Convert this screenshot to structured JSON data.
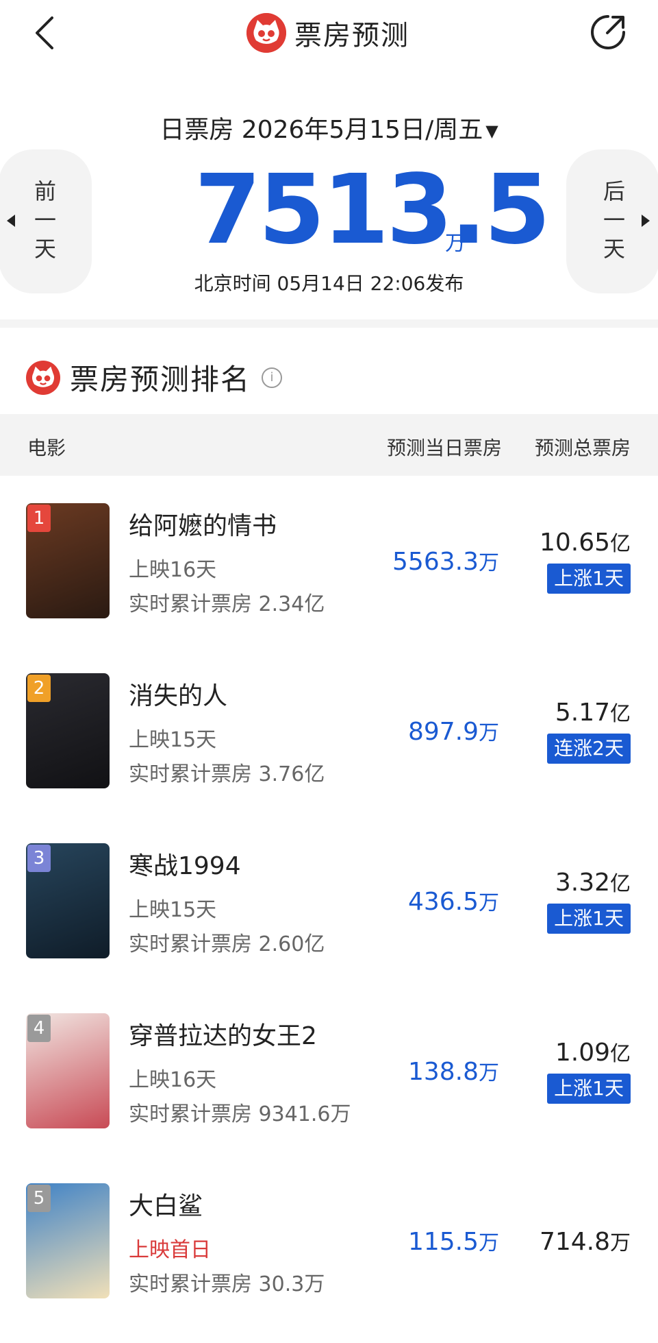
{
  "header": {
    "title": "票房预测"
  },
  "summary": {
    "date_label": "日票房 2026年5月15日/周五",
    "dropdown_arrow": "▼",
    "prev_day": "前一天",
    "next_day": "后一天",
    "box_office": "7513.5",
    "unit": "万",
    "publish_time": "北京时间  05月14日  22:06发布"
  },
  "section": {
    "title": "票房预测排名",
    "info_icon": "i"
  },
  "table": {
    "headers": {
      "movie": "电影",
      "day": "预测当日票房",
      "total": "预测总票房"
    },
    "rows": [
      {
        "rank": "1",
        "title": "给阿嬷的情书",
        "days": "上映16天",
        "cumulative": "实时累计票房 2.34亿",
        "day_value": "5563.3",
        "day_unit": "万",
        "total_value": "10.65",
        "total_unit": "亿",
        "tag": "上涨1天",
        "rank_color": "#e5473c",
        "poster_colors": [
          "#6b3a22",
          "#2a1a12"
        ]
      },
      {
        "rank": "2",
        "title": "消失的人",
        "days": "上映15天",
        "cumulative": "实时累计票房 3.76亿",
        "day_value": "897.9",
        "day_unit": "万",
        "total_value": "5.17",
        "total_unit": "亿",
        "tag": "连涨2天",
        "rank_color": "#f0a028",
        "poster_colors": [
          "#2a2a30",
          "#111114"
        ]
      },
      {
        "rank": "3",
        "title": "寒战1994",
        "days": "上映15天",
        "cumulative": "实时累计票房 2.60亿",
        "day_value": "436.5",
        "day_unit": "万",
        "total_value": "3.32",
        "total_unit": "亿",
        "tag": "上涨1天",
        "rank_color": "#7b84d6",
        "poster_colors": [
          "#27455c",
          "#0f1c28"
        ]
      },
      {
        "rank": "4",
        "title": "穿普拉达的女王2",
        "days": "上映16天",
        "cumulative": "实时累计票房 9341.6万",
        "day_value": "138.8",
        "day_unit": "万",
        "total_value": "1.09",
        "total_unit": "亿",
        "tag": "上涨1天",
        "rank_color": "#9a9a9a",
        "poster_colors": [
          "#f1e6e2",
          "#c84a55"
        ]
      },
      {
        "rank": "5",
        "title": "大白鲨",
        "days": "上映首日",
        "days_highlight": true,
        "cumulative": "实时累计票房 30.3万",
        "day_value": "115.5",
        "day_unit": "万",
        "total_value": "714.8",
        "total_unit": "万",
        "tag": "",
        "rank_color": "#9a9a9a",
        "poster_colors": [
          "#3f82c6",
          "#f1e0b8"
        ]
      }
    ]
  }
}
